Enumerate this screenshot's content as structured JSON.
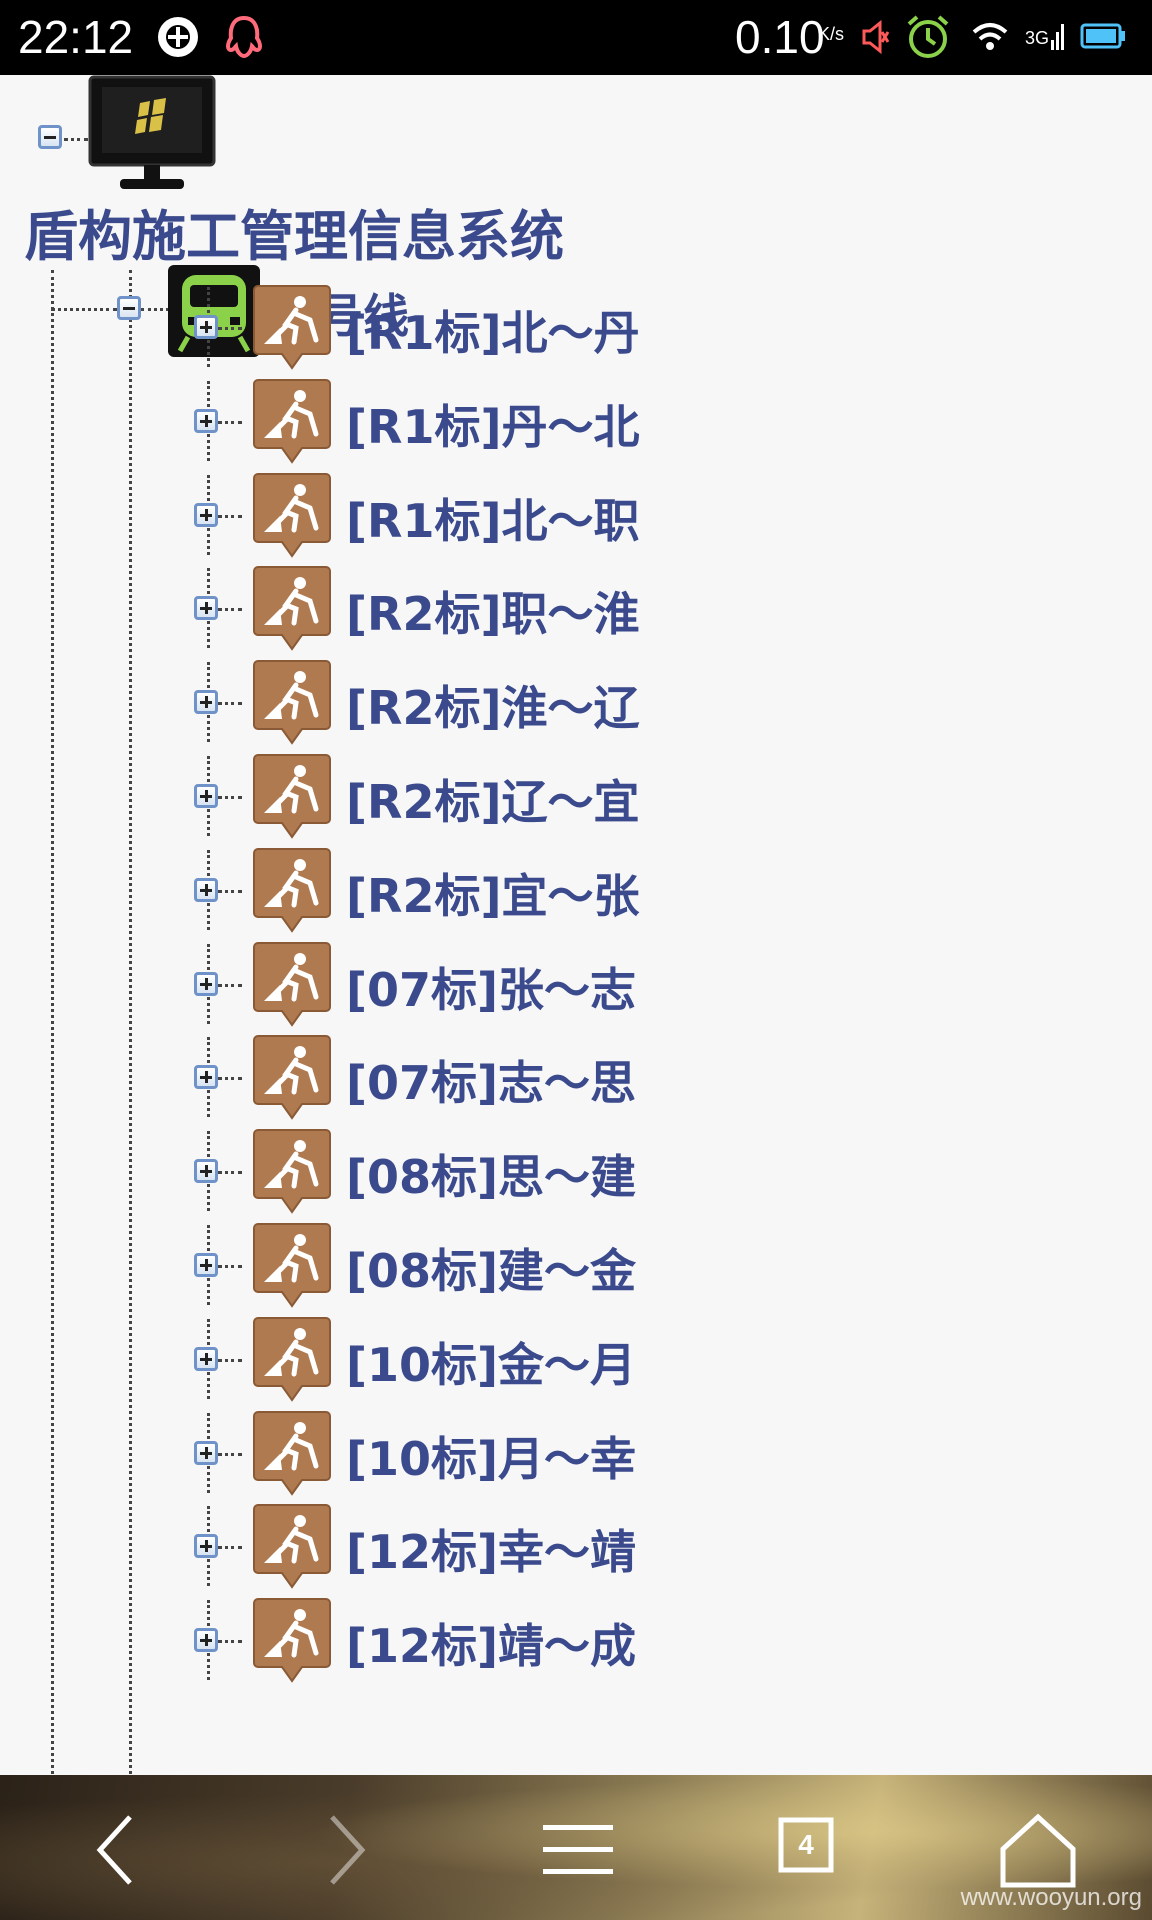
{
  "status_bar": {
    "time": "22:12",
    "net_speed": "0.10",
    "net_speed_unit": "K/s",
    "network_type": "3G",
    "icons": [
      "sync-icon",
      "qq-icon",
      "mute-icon",
      "alarm-icon",
      "wifi-icon",
      "signal-icon",
      "battery-icon"
    ]
  },
  "tree": {
    "root": {
      "label": "盾构施工管理信息系统",
      "icon": "monitor-icon",
      "expanded": true
    },
    "line": {
      "label": "五号线",
      "icon": "train-icon",
      "expanded": true
    },
    "sections": [
      {
        "label": "[R1标]北～丹"
      },
      {
        "label": "[R1标]丹～北"
      },
      {
        "label": "[R1标]北～职"
      },
      {
        "label": "[R2标]职～淮"
      },
      {
        "label": "[R2标]淮～辽"
      },
      {
        "label": "[R2标]辽～宜"
      },
      {
        "label": "[R2标]宜～张"
      },
      {
        "label": "[07标]张～志"
      },
      {
        "label": "[07标]志～思"
      },
      {
        "label": "[08标]思～建"
      },
      {
        "label": "[08标]建～金"
      },
      {
        "label": "[10标]金～月"
      },
      {
        "label": "[10标]月～幸"
      },
      {
        "label": "[12标]幸～靖"
      },
      {
        "label": "[12标]靖～成"
      }
    ]
  },
  "nav_bar": {
    "tab_count": "4",
    "buttons": [
      "back-icon",
      "forward-icon",
      "menu-icon",
      "tabs-icon",
      "home-icon"
    ],
    "watermark": "www.wooyun.org"
  },
  "colors": {
    "label_text": "#3a4a8c",
    "construction_icon": "#b07a50",
    "train_icon": "#8bd14a"
  }
}
